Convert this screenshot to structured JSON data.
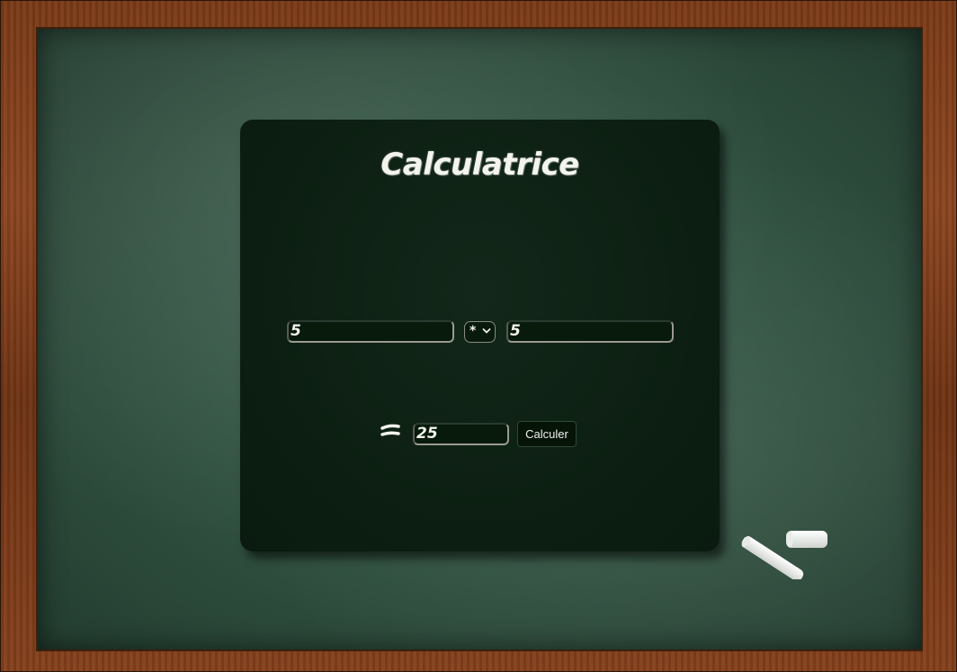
{
  "calculator": {
    "title": "Calculatrice",
    "operand_a": "5",
    "operator": "*",
    "operand_b": "5",
    "result": "25",
    "button_label": "Calculer"
  }
}
